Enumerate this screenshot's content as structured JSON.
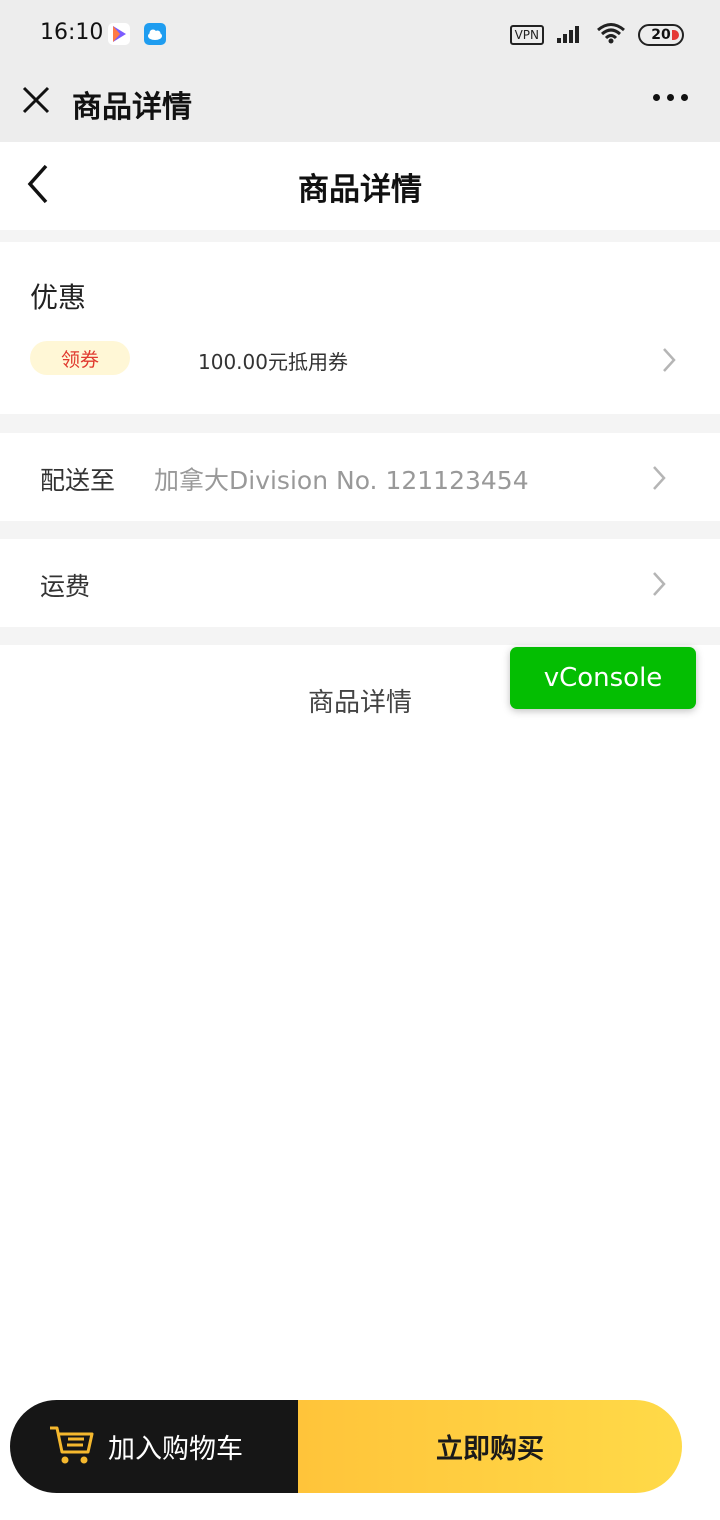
{
  "status_bar": {
    "time": "16:10",
    "vpn": "VPN",
    "battery": "20",
    "icons": [
      "play-store-icon",
      "cloud-icon",
      "signal-icon",
      "wifi-icon",
      "battery-icon"
    ]
  },
  "mini_bar": {
    "title": "商品详情",
    "icons": [
      "close-icon",
      "more-icon"
    ]
  },
  "header": {
    "title": "商品详情",
    "icons": [
      "back-icon"
    ]
  },
  "promo": {
    "title": "优惠",
    "coupon_badge": "领券",
    "coupon_text": "100.00元抵用券"
  },
  "delivery": {
    "label": "配送至",
    "value": "加拿大Division No. 121123454"
  },
  "shipping": {
    "label": "运费"
  },
  "detail_section": {
    "title": "商品详情"
  },
  "vconsole": {
    "label": "vConsole"
  },
  "actions": {
    "add_to_cart": "加入购物车",
    "buy_now": "立即购买"
  },
  "colors": {
    "accent_yellow": "#ffc43a",
    "dark": "#161616",
    "coupon_red": "#e03a2f",
    "vconsole_green": "#04be02",
    "chrome_gray": "#ededed"
  }
}
